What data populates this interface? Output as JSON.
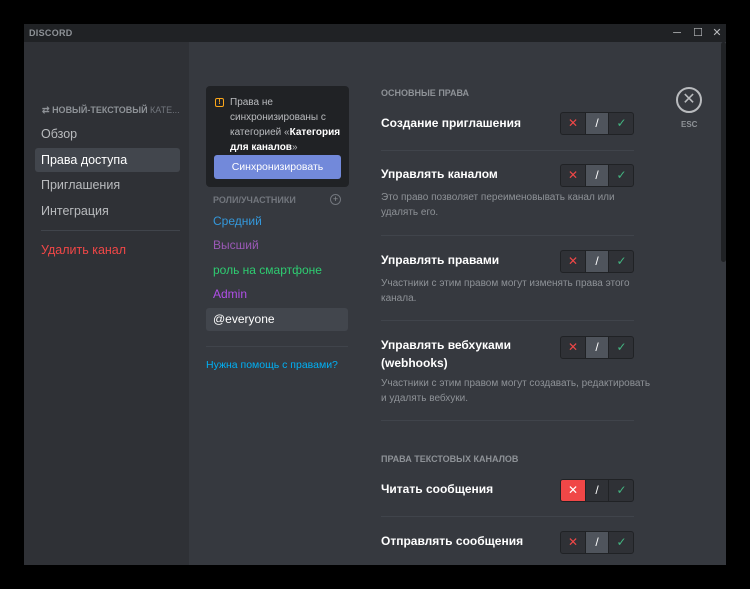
{
  "app": {
    "logo": "DISCORD"
  },
  "window_controls": {
    "minimize": "─",
    "maximize": "☐",
    "close": "✕"
  },
  "sidebar": {
    "header_icon": "⇄",
    "header": "НОВЫЙ-ТЕКСТОВЫЙ",
    "header_truncated": " КАТЕ...",
    "items": [
      {
        "label": "Обзор"
      },
      {
        "label": "Права доступа"
      },
      {
        "label": "Приглашения"
      },
      {
        "label": "Интеграция"
      }
    ],
    "delete_label": "Удалить канал"
  },
  "sync": {
    "text_before": "Права не синхронизированы с категорией «",
    "category_name": "Категория для каналов",
    "text_after": "»",
    "button": "Синхронизировать"
  },
  "roles": {
    "header": "РОЛИ/УЧАСТНИКИ",
    "items": [
      {
        "name": "Средний",
        "color": "#3498db"
      },
      {
        "name": "Высший",
        "color": "#9b59b6"
      },
      {
        "name": "роль на смартфоне",
        "color": "#2ecc71"
      },
      {
        "name": "Admin",
        "color": "#b04fe8"
      },
      {
        "name": "@everyone",
        "color": "#ffffff"
      }
    ],
    "help_link": "Нужна помощь с правами?"
  },
  "permissions": {
    "general_header": "ОСНОВНЫЕ ПРАВА",
    "text_header": "ПРАВА ТЕКСТОВЫХ КАНАЛОВ",
    "items": [
      {
        "title": "Создание приглашения",
        "description": "",
        "state": "neutral"
      },
      {
        "title": "Управлять каналом",
        "description": "Это право позволяет переименовывать канал или удалять его.",
        "state": "neutral"
      },
      {
        "title": "Управлять правами",
        "description": "Участники с этим правом могут изменять права этого канала.",
        "state": "neutral"
      },
      {
        "title": "Управлять вебхуками (webhooks)",
        "description": "Участники с этим правом могут создавать, редактировать и удалять вебхуки.",
        "state": "neutral"
      },
      {
        "title": "Читать сообщения",
        "description": "",
        "state": "deny"
      },
      {
        "title": "Отправлять сообщения",
        "description": "",
        "state": "neutral"
      }
    ],
    "toggle_symbols": {
      "deny": "✕",
      "neutral": "/",
      "allow": "✓"
    }
  },
  "esc": {
    "icon": "✕",
    "label": "ESC"
  },
  "colors": {
    "accent": "#7289da",
    "danger": "#f04747",
    "success": "#43b581",
    "link": "#00b0f4"
  }
}
